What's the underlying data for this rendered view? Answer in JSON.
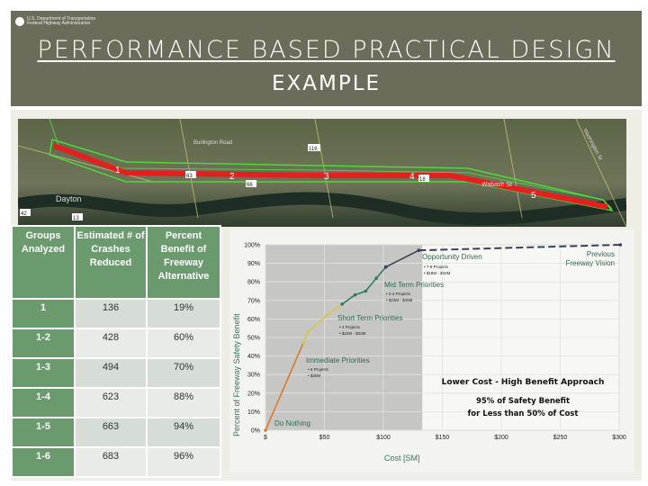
{
  "header": {
    "agency_line1": "U.S. Department of Transportation",
    "agency_line2": "Federal Highway Administration",
    "title_line1": "PERFORMANCE BASED PRACTICAL DESIGN",
    "title_line2": "EXAMPLE"
  },
  "map": {
    "place_labels": [
      "Dayton",
      "Burlington Road",
      "Washington St",
      "Wabash St"
    ],
    "route_shields": [
      "42",
      "13",
      "63",
      "66",
      "116",
      "18"
    ],
    "segments": [
      "1",
      "2",
      "3",
      "4",
      "5"
    ]
  },
  "table": {
    "headers": [
      "Groups Analyzed",
      "Estimated # of Crashes Reduced",
      "Percent Benefit of Freeway Alternative"
    ],
    "rows": [
      [
        "1",
        "136",
        "19%"
      ],
      [
        "1-2",
        "428",
        "60%"
      ],
      [
        "1-3",
        "494",
        "70%"
      ],
      [
        "1-4",
        "623",
        "88%"
      ],
      [
        "1-5",
        "663",
        "94%"
      ],
      [
        "1-6",
        "683",
        "96%"
      ]
    ]
  },
  "chart_data": {
    "type": "line",
    "xlabel": "Cost [SM]",
    "ylabel": "Percent of Freeway Safety Benefit",
    "xlim": [
      0,
      300
    ],
    "ylim": [
      0,
      100
    ],
    "x_ticks": [
      "$",
      "$50",
      "$100",
      "$150",
      "$200",
      "$250",
      "$300"
    ],
    "y_ticks": [
      "0%",
      "10%",
      "20%",
      "30%",
      "40%",
      "50%",
      "60%",
      "70%",
      "80%",
      "90%",
      "100%"
    ],
    "grid": true,
    "shaded_range_x": [
      0,
      133
    ],
    "series": [
      {
        "name": "Immediate Priorities",
        "color": "#d9782f",
        "x": [
          0,
          32
        ],
        "y": [
          0,
          47
        ]
      },
      {
        "name": "Short Term Priorities",
        "color": "#d6c455",
        "x": [
          32,
          36,
          52,
          65
        ],
        "y": [
          47,
          53,
          62,
          68
        ]
      },
      {
        "name": "Mid Term Priorities",
        "color": "#2e7a62",
        "x": [
          65,
          76,
          85,
          94,
          102
        ],
        "y": [
          68,
          73,
          75,
          82,
          88
        ]
      },
      {
        "name": "Opportunity Driven",
        "color": "#3b3f5c",
        "x": [
          102,
          130
        ],
        "y": [
          88,
          97
        ]
      },
      {
        "name": "Previous Freeway Vision",
        "color": "#3b3f5c",
        "dashed": true,
        "x": [
          130,
          301
        ],
        "y": [
          97,
          100
        ]
      }
    ],
    "annotations": {
      "do_nothing": "Do Nothing",
      "immediate": {
        "title": "Immediate Priorities",
        "b1": "• 6 Projects",
        "b2": "• $30M"
      },
      "short": {
        "title": "Short Term Priorities",
        "b1": "• 4 Projects",
        "b2": "• $22M - $32M"
      },
      "mid": {
        "title": "Mid Term Priorities",
        "b1": "• 2-4 Projects",
        "b2": "• $23M - $45M"
      },
      "opp": {
        "title": "Opportunity Driven",
        "b1": "• 7-9 Projects",
        "b2": "• $18M - $44M"
      },
      "prev1": "Previous",
      "prev2": "Freeway Vision",
      "headline": "Lower Cost - High Benefit Approach",
      "sub1": "95% of Safety Benefit",
      "sub2": "for Less than 50% of Cost"
    }
  }
}
